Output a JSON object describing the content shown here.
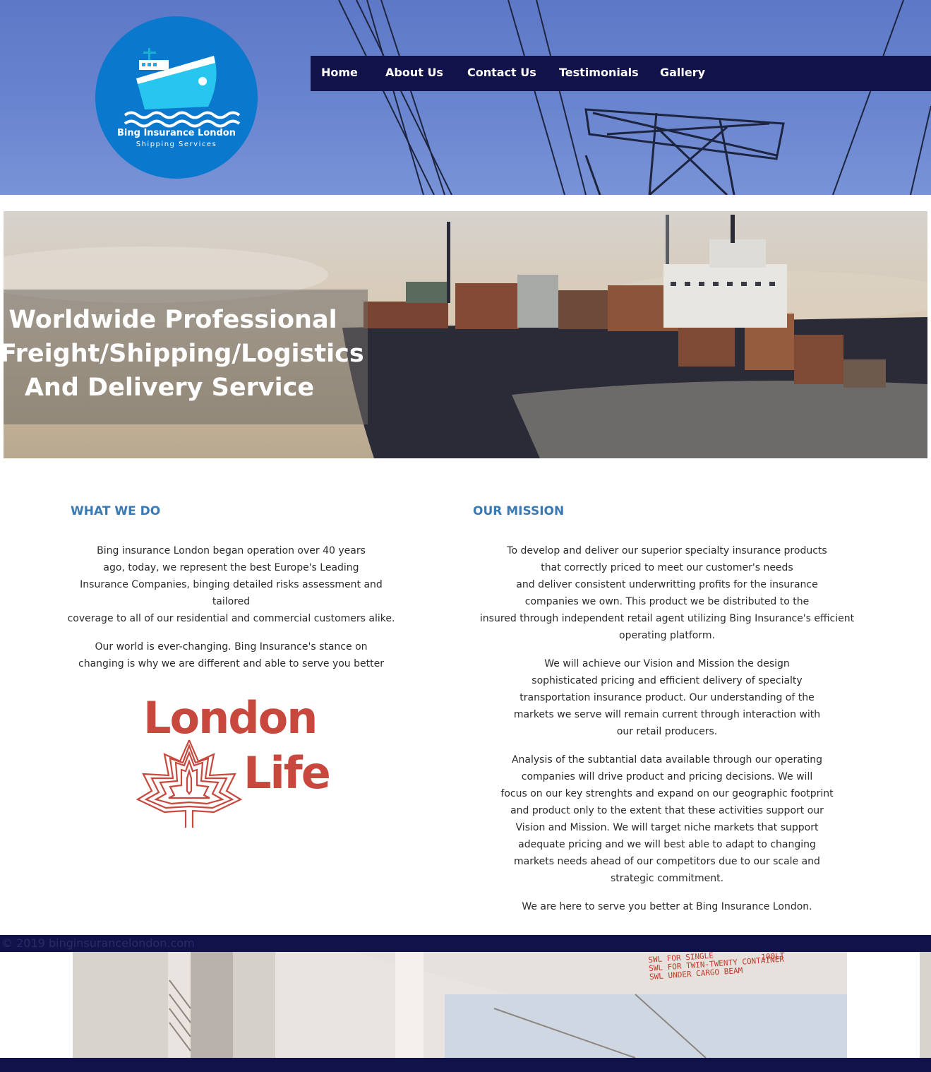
{
  "brand": {
    "name": "Bing Insurance London",
    "tagline": "Shipping Services"
  },
  "nav": {
    "items": [
      {
        "label": "Home"
      },
      {
        "label": "About Us"
      },
      {
        "label": "Contact Us"
      },
      {
        "label": "Testimonials"
      },
      {
        "label": "Gallery"
      }
    ]
  },
  "hero": {
    "lines": [
      "Worldwide Professional",
      "Freight/Shipping/Logistics",
      "And Delivery Service"
    ]
  },
  "what_we_do": {
    "heading": "WHAT WE DO",
    "paragraphs": [
      [
        "Bing insurance London began operation over 40 years",
        "ago, today, we represent the best Europe's Leading",
        "Insurance Companies, binging detailed risks assessment and tailored",
        "coverage to all of our residential and commercial customers alike."
      ],
      [
        "Our world is ever-changing. Bing Insurance's stance on",
        "changing is why we are different and able to serve you better"
      ]
    ],
    "partner_logo": {
      "word1": "London",
      "word2": "Life",
      "color": "#c9483d"
    }
  },
  "mission": {
    "heading": "OUR MISSION",
    "paragraphs": [
      [
        "To develop and deliver our superior specialty insurance products",
        "that correctly priced to meet our customer's needs",
        "and deliver consistent underwritting profits for the insurance",
        "companies we own. This product we be distributed to the",
        "insured through independent retail agent utilizing Bing Insurance's efficient",
        "operating platform."
      ],
      [
        "We will achieve our Vision and Mission the design",
        "sophisticated pricing and efficient delivery of specialty",
        "transportation insurance product. Our understanding of the",
        "markets we serve will remain current through interaction with",
        "our retail producers."
      ],
      [
        "Analysis of the subtantial data available through our operating",
        "companies will drive product and pricing decisions. We will",
        "focus on our key strenghts and expand on our geographic footprint",
        "and product only to the extent that these activities support our",
        "Vision and Mission. We will target niche markets that support",
        "adequate pricing and we will best able to adapt to changing",
        "markets needs ahead of our competitors due to our scale and",
        "strategic commitment."
      ],
      [
        "We are here to serve you better at Bing Insurance London."
      ]
    ]
  },
  "footer": {
    "copyright": "© 2019 binginsurancelondon.com",
    "crane_labels": [
      "SWL FOR SINGLE",
      "SWL FOR TWIN-TWENTY CONTAINER",
      "SWL UNDER CARGO BEAM"
    ],
    "crane_weight": "100LT"
  },
  "colors": {
    "nav_bg": "#12124a",
    "heading": "#3a7ab4",
    "logo_circle": "#0a78cd",
    "header_sky": "#6a85cf"
  }
}
